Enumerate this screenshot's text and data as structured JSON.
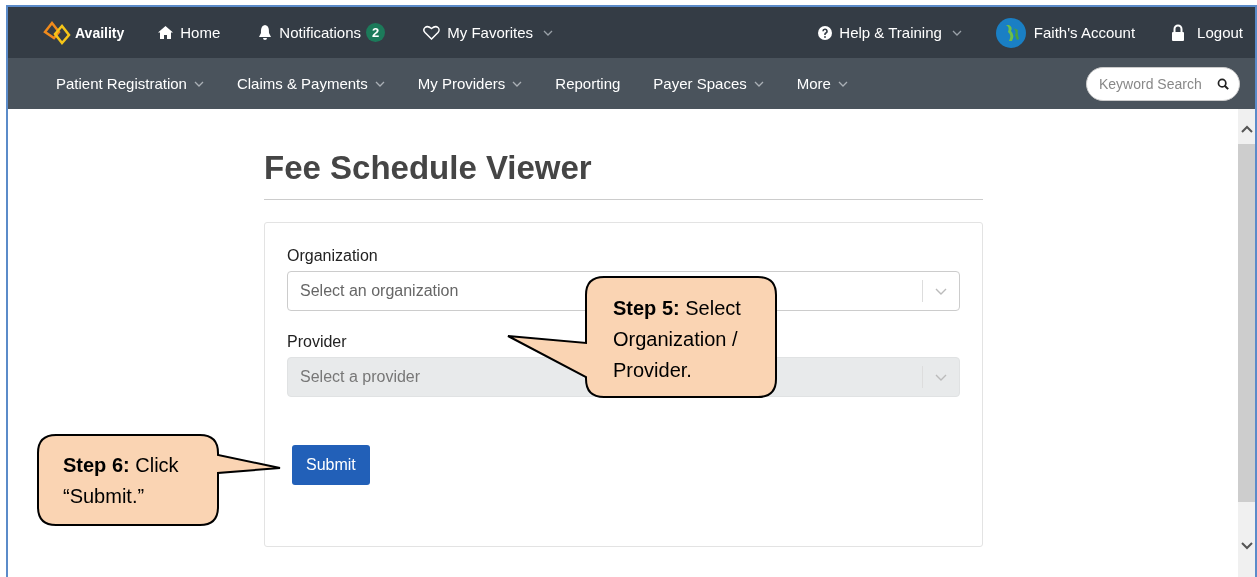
{
  "top_bar": {
    "logo": "Availity",
    "items": [
      {
        "kind": "home",
        "label": "Home"
      },
      {
        "kind": "notifications",
        "label": "Notifications",
        "badge": "2"
      },
      {
        "kind": "favorites",
        "label": "My Favorites",
        "dropdown": true
      }
    ],
    "right_items": [
      {
        "kind": "help",
        "label": "Help & Training",
        "dropdown": true
      },
      {
        "kind": "account",
        "label": "Faith's Account",
        "dropdown": false
      },
      {
        "kind": "logout",
        "label": "Logout",
        "dropdown": false
      }
    ]
  },
  "main_nav": {
    "items": [
      {
        "label": "Patient Registration",
        "dropdown": true
      },
      {
        "label": "Claims & Payments",
        "dropdown": true
      },
      {
        "label": "My Providers",
        "dropdown": true
      },
      {
        "label": "Reporting",
        "dropdown": false
      },
      {
        "label": "Payer Spaces",
        "dropdown": true
      },
      {
        "label": "More",
        "dropdown": true
      }
    ],
    "search": {
      "placeholder": "Keyword Search"
    }
  },
  "page": {
    "title": "Fee Schedule Viewer",
    "fields": [
      {
        "label": "Organization",
        "placeholder": "Select an organization",
        "disabled": false
      },
      {
        "label": "Provider",
        "placeholder": "Select a provider",
        "disabled": true
      }
    ],
    "submit": "Submit"
  },
  "callouts": [
    {
      "text": "**Step 5:** Select Organization / Provider."
    },
    {
      "text": "**Step 6:** Click “Submit.”"
    }
  ]
}
